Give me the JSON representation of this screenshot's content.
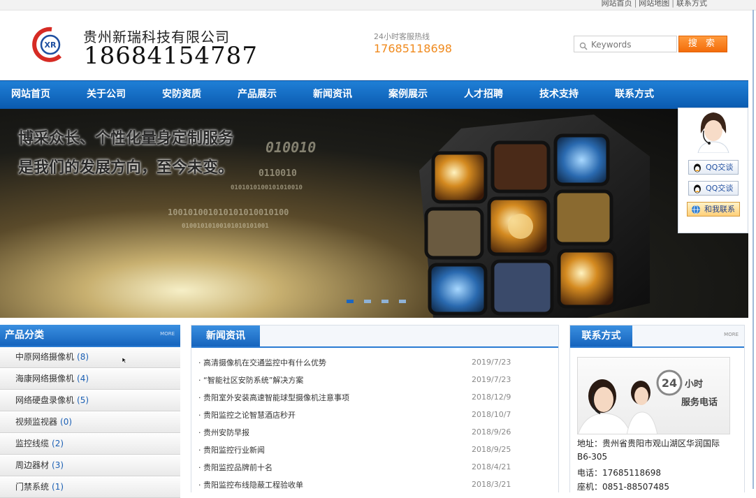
{
  "topbar": {
    "links": [
      "网站首页",
      "网站地图",
      "联系方式"
    ],
    "separator": "|"
  },
  "header": {
    "logo_text": "XR",
    "company_name": "贵州新瑞科技有限公司",
    "phone": "18684154787",
    "hotline_label": "24小时客服热线",
    "hotline_number": "17685118698"
  },
  "search": {
    "placeholder": "Keywords",
    "button_label": "搜 索"
  },
  "nav": {
    "items": [
      "网站首页",
      "关于公司",
      "安防资质",
      "产品展示",
      "新闻资讯",
      "案例展示",
      "人才招聘",
      "技术支持",
      "联系方式"
    ]
  },
  "banner": {
    "slogan_line1": "博采众长、个性化量身定制服务",
    "slogan_line2": "是我们的发展方向，至今未变。",
    "slide_count": 4,
    "active_slide": 1
  },
  "qq_panel": {
    "buttons": [
      "QQ交谈",
      "QQ交谈",
      "和我联系"
    ]
  },
  "products": {
    "title": "产品分类",
    "more": "MORE",
    "items": [
      {
        "label": "中原网络摄像机",
        "count": "(8)"
      },
      {
        "label": "海康网络摄像机",
        "count": "(4)"
      },
      {
        "label": "网络硬盘录像机",
        "count": "(5)"
      },
      {
        "label": "视频监视器",
        "count": "(0)"
      },
      {
        "label": "监控线缆",
        "count": "(2)"
      },
      {
        "label": "周边器材",
        "count": "(3)"
      },
      {
        "label": "门禁系统",
        "count": "(1)"
      }
    ]
  },
  "news": {
    "title": "新闻资讯",
    "items": [
      {
        "title": "高清摄像机在交通监控中有什么优势",
        "date": "2019/7/23"
      },
      {
        "title": "“智能社区安防系统”解决方案",
        "date": "2019/7/23"
      },
      {
        "title": "贵阳室外安装高速智能球型摄像机注意事项",
        "date": "2018/12/9"
      },
      {
        "title": "贵阳监控之论智慧酒店秒开",
        "date": "2018/10/7"
      },
      {
        "title": "贵州安防早报",
        "date": "2018/9/26"
      },
      {
        "title": "贵阳监控行业新闻",
        "date": "2018/9/25"
      },
      {
        "title": "贵阳监控品牌前十名",
        "date": "2018/4/21"
      },
      {
        "title": "贵阳监控布线隐蔽工程验收单",
        "date": "2018/3/21"
      }
    ]
  },
  "contact": {
    "title": "联系方式",
    "more": "MORE",
    "badge_num": "24",
    "badge_line1": "小时",
    "badge_line2": "服务电话",
    "address_line1": "地址：贵州省贵阳市观山湖区华润国际",
    "address_line2": "B6-305",
    "phone": "电话：17685118698",
    "landline": "座机：0851-88507485"
  },
  "colors": {
    "nav_blue": "#0b5bb0",
    "accent_orange": "#f36c0a",
    "hotline_orange": "#f08a1d",
    "link_blue": "#1a5fb4"
  }
}
